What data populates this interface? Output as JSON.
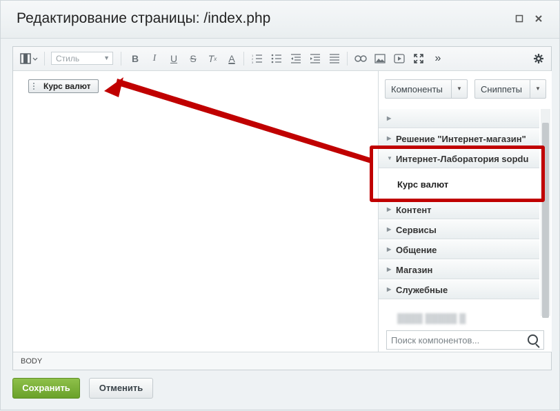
{
  "dialog": {
    "title": "Редактирование страницы: /index.php"
  },
  "toolbar": {
    "style_placeholder": "Стиль",
    "icons": [
      "blocks-icon",
      "bold-icon",
      "italic-icon",
      "underline-icon",
      "strikethrough-icon",
      "remove-format-icon",
      "font-color-icon",
      "ordered-list-icon",
      "unordered-list-icon",
      "outdent-icon",
      "indent-icon",
      "align-icon",
      "link-icon",
      "image-icon",
      "video-icon",
      "fullscreen-icon",
      "more-icon",
      "settings-icon"
    ]
  },
  "content": {
    "chip_label": "Курс валют"
  },
  "sidebar": {
    "components_button": "Компоненты",
    "snippets_button": "Сниппеты",
    "items": [
      {
        "label": "",
        "expanded": false
      },
      {
        "label": "Решение \"Интернет-магазин\"",
        "expanded": false
      },
      {
        "label": "Интернет-Лаборатория sopdu",
        "expanded": true
      },
      {
        "label": "Контент",
        "expanded": false
      },
      {
        "label": "Сервисы",
        "expanded": false
      },
      {
        "label": "Общение",
        "expanded": false
      },
      {
        "label": "Магазин",
        "expanded": false
      },
      {
        "label": "Служебные",
        "expanded": false
      }
    ],
    "sub_item": "Курс валют",
    "search_placeholder": "Поиск компонентов..."
  },
  "statusbar": {
    "path": "BODY"
  },
  "footer": {
    "save_label": "Сохранить",
    "cancel_label": "Отменить"
  },
  "annotation": {
    "highlight_color": "#c00000"
  }
}
